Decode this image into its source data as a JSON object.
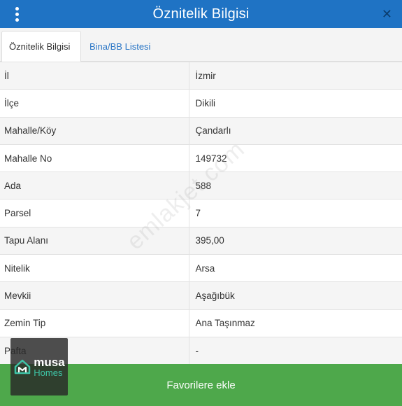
{
  "header": {
    "title": "Öznitelik Bilgisi",
    "close_label": "✕",
    "menu_icon": "vertical-ellipsis-icon"
  },
  "tabs": [
    {
      "label": "Öznitelik Bilgisi",
      "active": true
    },
    {
      "label": "Bina/BB Listesi",
      "active": false
    }
  ],
  "rows": [
    {
      "key": "İl",
      "value": "İzmir"
    },
    {
      "key": "İlçe",
      "value": "Dikili"
    },
    {
      "key": "Mahalle/Köy",
      "value": "Çandarlı"
    },
    {
      "key": "Mahalle No",
      "value": "149732"
    },
    {
      "key": "Ada",
      "value": "588"
    },
    {
      "key": "Parsel",
      "value": "7"
    },
    {
      "key": "Tapu Alanı",
      "value": "395,00"
    },
    {
      "key": "Nitelik",
      "value": "Arsa"
    },
    {
      "key": "Mevkii",
      "value": "Aşağıbük"
    },
    {
      "key": "Zemin Tip",
      "value": "Ana Taşınmaz"
    },
    {
      "key": "Pafta",
      "value": "-"
    }
  ],
  "footer": {
    "button_label": "Favorilere ekle"
  },
  "watermark": {
    "text": "emlakjet.com"
  },
  "logo": {
    "line1": "musa",
    "line2": "Homes"
  },
  "colors": {
    "header_bg": "#1f73c4",
    "footer_bg": "#4ea84b",
    "tab_link": "#2a76c6"
  }
}
